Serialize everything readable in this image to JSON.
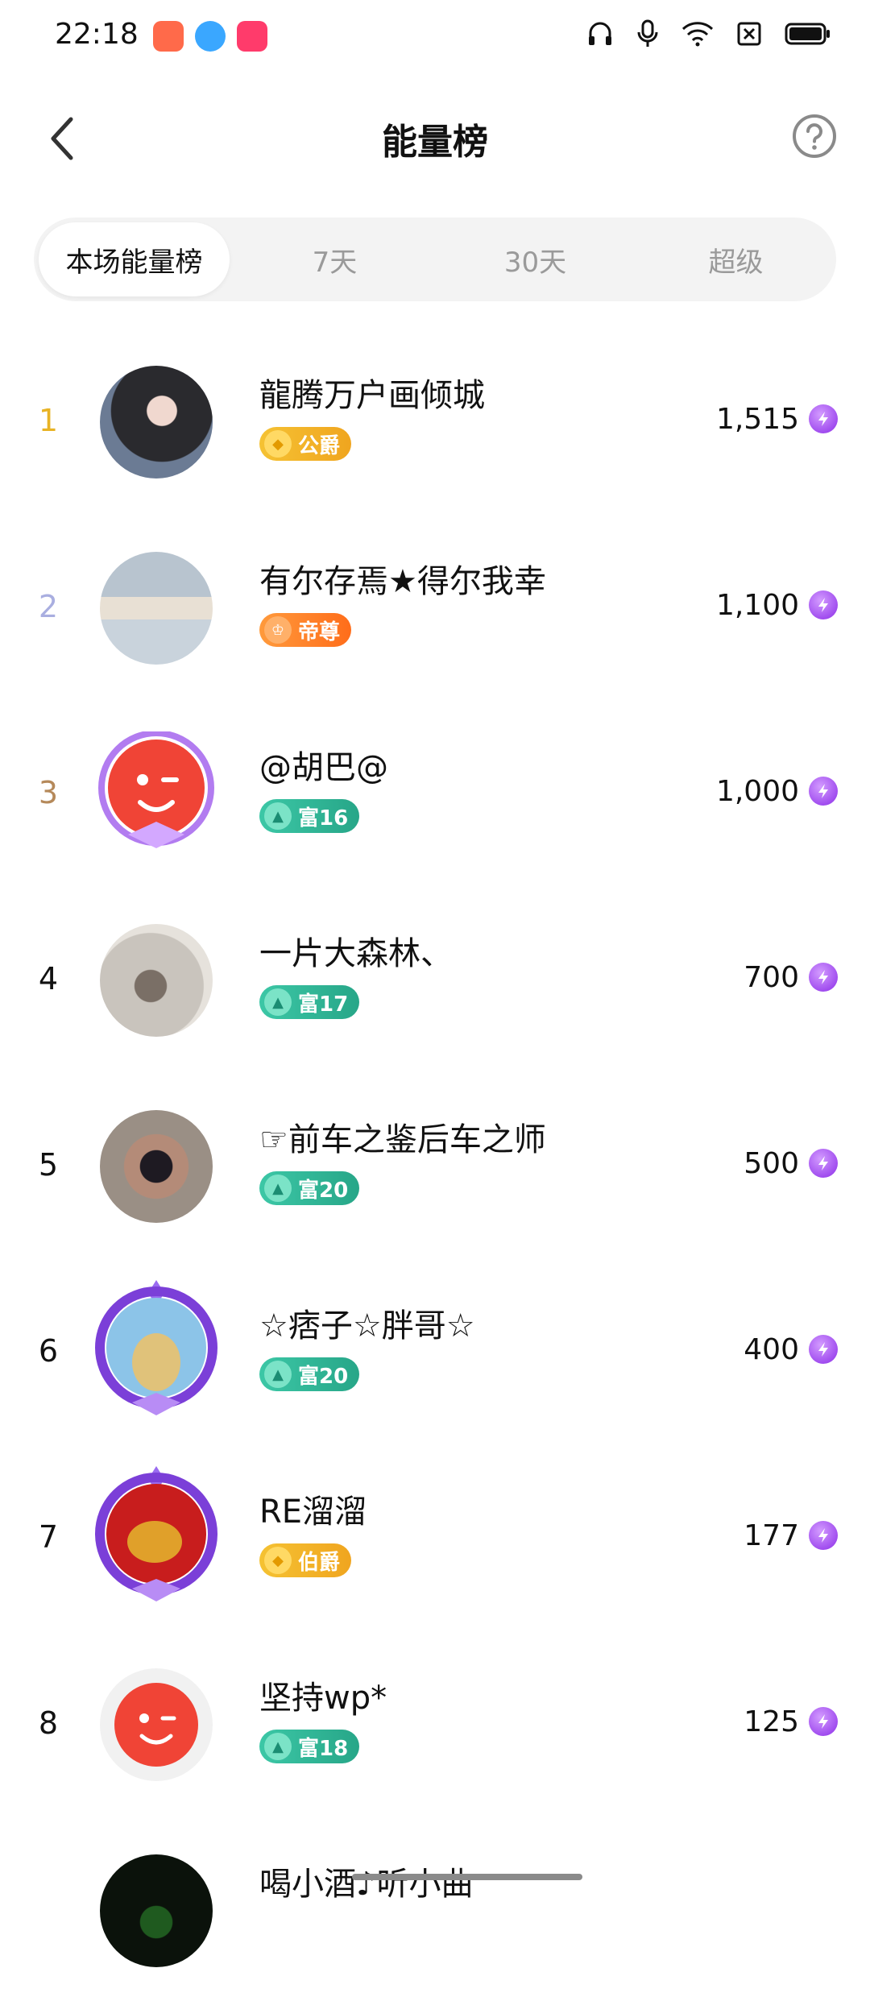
{
  "status_bar": {
    "time": "22:18",
    "app_icons": [
      {
        "name": "app-icon-1",
        "color": "#ff6a4a"
      },
      {
        "name": "app-icon-2",
        "color": "#3aa7ff"
      },
      {
        "name": "app-icon-3",
        "color": "#ff3b6b"
      }
    ],
    "icons": [
      "headphones-icon",
      "microphone-icon",
      "wifi-icon",
      "sim-icon",
      "battery-icon"
    ]
  },
  "header": {
    "title": "能量榜",
    "back_icon": "chevron-left-icon",
    "help_icon": "question-circle-icon"
  },
  "tabs": [
    {
      "label": "本场能量榜",
      "active": true
    },
    {
      "label": "7天",
      "active": false
    },
    {
      "label": "30天",
      "active": false
    },
    {
      "label": "超级",
      "active": false
    }
  ],
  "colors": {
    "rank1": "#e8b325",
    "rank2": "#a9aee0",
    "rank3": "#b5895a",
    "rank_default": "#222222",
    "energy": "#9b3ef0"
  },
  "rows": [
    {
      "rank": "1",
      "name": "龍腾万户画倾城",
      "badge": {
        "label": "公爵",
        "style": "gold"
      },
      "score": "1,515"
    },
    {
      "rank": "2",
      "name": "有尔存焉★得尔我幸",
      "badge": {
        "label": "帝尊",
        "style": "orange"
      },
      "score": "1,100"
    },
    {
      "rank": "3",
      "name": "@胡巴@",
      "badge": {
        "label": "富16",
        "style": "teal"
      },
      "score": "1,000"
    },
    {
      "rank": "4",
      "name": "一片大森林、",
      "badge": {
        "label": "富17",
        "style": "teal"
      },
      "score": "700"
    },
    {
      "rank": "5",
      "name": "☞前车之鉴后车之师",
      "badge": {
        "label": "富20",
        "style": "teal"
      },
      "score": "500"
    },
    {
      "rank": "6",
      "name": "☆痞子☆胖哥☆",
      "badge": {
        "label": "富20",
        "style": "teal"
      },
      "score": "400"
    },
    {
      "rank": "7",
      "name": "RE溜溜",
      "badge": {
        "label": "伯爵",
        "style": "gold"
      },
      "score": "177"
    },
    {
      "rank": "8",
      "name": "坚持wp*",
      "badge": {
        "label": "富18",
        "style": "teal"
      },
      "score": "125"
    },
    {
      "rank": "",
      "name": "喝小酒♪听小曲",
      "badge": null,
      "score": ""
    }
  ]
}
